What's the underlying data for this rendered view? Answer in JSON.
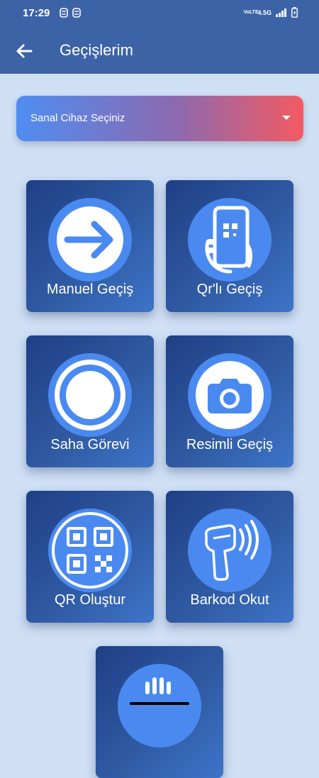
{
  "status_bar": {
    "time": "17:29",
    "network": "4.5G",
    "volte": "VoLTE"
  },
  "appbar": {
    "title": "Geçişlerim"
  },
  "device_select": {
    "placeholder": "Sanal Cihaz Seçiniz"
  },
  "tiles": [
    {
      "label": "Manuel Geçiş",
      "icon": "arrow-right-icon"
    },
    {
      "label": "Qr'lı Geçiş",
      "icon": "qr-phone-icon"
    },
    {
      "label": "Saha Görevi",
      "icon": "record-circle-icon"
    },
    {
      "label": "Resimli Geçiş",
      "icon": "camera-icon"
    },
    {
      "label": "QR Oluştur",
      "icon": "qr-code-icon"
    },
    {
      "label": "Barkod Okut",
      "icon": "barcode-scanner-icon"
    },
    {
      "label": "",
      "icon": "hand-icon"
    }
  ],
  "colors": {
    "appbar": "#3c63a6",
    "tile": "#2f5aa2",
    "accent_circle": "#4a8af0",
    "gradient_start": "#4f8df2",
    "gradient_end": "#f45a62"
  }
}
